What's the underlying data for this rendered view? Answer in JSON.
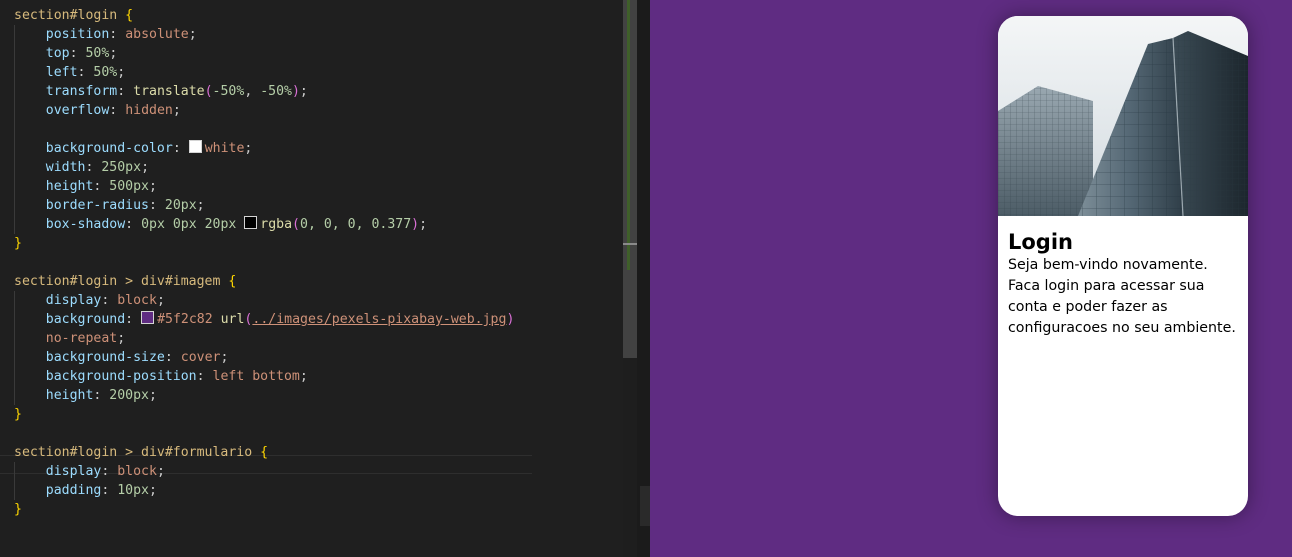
{
  "editor": {
    "lines": [
      {
        "indent": false,
        "tokens": [
          {
            "t": "section#login ",
            "c": "sel"
          },
          {
            "t": "{",
            "c": "br"
          }
        ]
      },
      {
        "indent": true,
        "tokens": [
          {
            "t": "position",
            "c": "prop"
          },
          {
            "t": ": "
          },
          {
            "t": "absolute",
            "c": "val"
          },
          {
            "t": ";"
          }
        ]
      },
      {
        "indent": true,
        "tokens": [
          {
            "t": "top",
            "c": "prop"
          },
          {
            "t": ": "
          },
          {
            "t": "50%",
            "c": "num"
          },
          {
            "t": ";"
          }
        ]
      },
      {
        "indent": true,
        "tokens": [
          {
            "t": "left",
            "c": "prop"
          },
          {
            "t": ": "
          },
          {
            "t": "50%",
            "c": "num"
          },
          {
            "t": ";"
          }
        ]
      },
      {
        "indent": true,
        "tokens": [
          {
            "t": "transform",
            "c": "prop"
          },
          {
            "t": ": "
          },
          {
            "t": "translate",
            "c": "fn"
          },
          {
            "t": "(",
            "c": "pbr"
          },
          {
            "t": "-50%",
            "c": "num"
          },
          {
            "t": ", "
          },
          {
            "t": "-50%",
            "c": "num"
          },
          {
            "t": ")",
            "c": "pbr"
          },
          {
            "t": ";"
          }
        ]
      },
      {
        "indent": true,
        "tokens": [
          {
            "t": "overflow",
            "c": "prop"
          },
          {
            "t": ": "
          },
          {
            "t": "hidden",
            "c": "val"
          },
          {
            "t": ";"
          }
        ]
      },
      {
        "indent": true,
        "tokens": []
      },
      {
        "indent": true,
        "tokens": [
          {
            "t": "background-color",
            "c": "prop"
          },
          {
            "t": ": "
          },
          {
            "swatch": "#ffffff"
          },
          {
            "t": "white",
            "c": "val"
          },
          {
            "t": ";"
          }
        ]
      },
      {
        "indent": true,
        "tokens": [
          {
            "t": "width",
            "c": "prop"
          },
          {
            "t": ": "
          },
          {
            "t": "250px",
            "c": "num"
          },
          {
            "t": ";"
          }
        ]
      },
      {
        "indent": true,
        "tokens": [
          {
            "t": "height",
            "c": "prop"
          },
          {
            "t": ": "
          },
          {
            "t": "500px",
            "c": "num"
          },
          {
            "t": ";"
          }
        ]
      },
      {
        "indent": true,
        "tokens": [
          {
            "t": "border-radius",
            "c": "prop"
          },
          {
            "t": ": "
          },
          {
            "t": "20px",
            "c": "num"
          },
          {
            "t": ";"
          }
        ]
      },
      {
        "indent": true,
        "tokens": [
          {
            "t": "box-shadow",
            "c": "prop"
          },
          {
            "t": ": "
          },
          {
            "t": "0px 0px 20px ",
            "c": "num"
          },
          {
            "swatch": "#000000"
          },
          {
            "t": "rgba",
            "c": "fn"
          },
          {
            "t": "(",
            "c": "pbr"
          },
          {
            "t": "0, 0, 0, 0.377",
            "c": "num"
          },
          {
            "t": ")",
            "c": "pbr"
          },
          {
            "t": ";"
          }
        ]
      },
      {
        "indent": false,
        "tokens": [
          {
            "t": "}",
            "c": "br"
          }
        ]
      },
      {
        "indent": false,
        "tokens": []
      },
      {
        "indent": false,
        "tokens": [
          {
            "t": "section#login > div#imagem ",
            "c": "sel"
          },
          {
            "t": "{",
            "c": "br"
          }
        ]
      },
      {
        "indent": true,
        "tokens": [
          {
            "t": "display",
            "c": "prop"
          },
          {
            "t": ": "
          },
          {
            "t": "block",
            "c": "val"
          },
          {
            "t": ";"
          }
        ]
      },
      {
        "indent": true,
        "tokens": [
          {
            "t": "background",
            "c": "prop"
          },
          {
            "t": ": "
          },
          {
            "swatch": "#5f2c82"
          },
          {
            "t": "#5f2c82 ",
            "c": "val"
          },
          {
            "t": "url",
            "c": "fn"
          },
          {
            "t": "(",
            "c": "pbr"
          },
          {
            "t": "../images/pexels-pixabay-web.jpg",
            "c": "url"
          },
          {
            "t": ")",
            "c": "pbr"
          }
        ]
      },
      {
        "indent": true,
        "tokens": [
          {
            "t": "no-repeat",
            "c": "val"
          },
          {
            "t": ";"
          }
        ]
      },
      {
        "indent": true,
        "tokens": [
          {
            "t": "background-size",
            "c": "prop"
          },
          {
            "t": ": "
          },
          {
            "t": "cover",
            "c": "val"
          },
          {
            "t": ";"
          }
        ]
      },
      {
        "indent": true,
        "tokens": [
          {
            "t": "background-position",
            "c": "prop"
          },
          {
            "t": ": "
          },
          {
            "t": "left bottom",
            "c": "val"
          },
          {
            "t": ";"
          }
        ]
      },
      {
        "indent": true,
        "tokens": [
          {
            "t": "height",
            "c": "prop"
          },
          {
            "t": ": "
          },
          {
            "t": "200px",
            "c": "num"
          },
          {
            "t": ";"
          }
        ]
      },
      {
        "indent": false,
        "tokens": [
          {
            "t": "}",
            "c": "br"
          }
        ]
      },
      {
        "indent": false,
        "tokens": []
      },
      {
        "indent": false,
        "tokens": [
          {
            "t": "section#login > div#formulario ",
            "c": "sel"
          },
          {
            "t": "{",
            "c": "br"
          }
        ]
      },
      {
        "indent": true,
        "tokens": [
          {
            "t": "display",
            "c": "prop"
          },
          {
            "t": ": "
          },
          {
            "t": "block",
            "c": "val"
          },
          {
            "t": ";"
          }
        ]
      },
      {
        "indent": true,
        "tokens": [
          {
            "t": "padding",
            "c": "prop"
          },
          {
            "t": ": "
          },
          {
            "t": "10px",
            "c": "num"
          },
          {
            "t": ";"
          }
        ]
      },
      {
        "indent": false,
        "tokens": [
          {
            "t": "}",
            "c": "br"
          }
        ]
      }
    ]
  },
  "preview": {
    "background": "#5f2c82",
    "card": {
      "title": "Login",
      "text": "Seja bem-vindo novamente. Faca login para acessar sua conta e poder fazer as configuracoes no seu ambiente.",
      "image_icon": "building-photo"
    }
  }
}
